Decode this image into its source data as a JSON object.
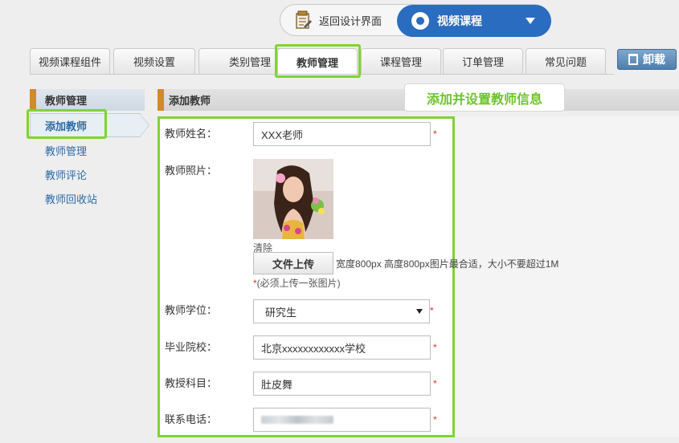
{
  "top": {
    "back_label": "返回设计界面",
    "course_label": "视频课程"
  },
  "tabs": [
    {
      "label": "视频课程组件"
    },
    {
      "label": "视频设置"
    },
    {
      "label": "类别管理"
    },
    {
      "label": "教师管理",
      "active": true
    },
    {
      "label": "课程管理"
    },
    {
      "label": "订单管理"
    },
    {
      "label": "常见问题"
    }
  ],
  "uninstall_label": "卸载",
  "sidebar": {
    "header": "教师管理",
    "items": [
      {
        "label": "添加教师",
        "active": true
      },
      {
        "label": "教师管理"
      },
      {
        "label": "教师评论"
      },
      {
        "label": "教师回收站"
      }
    ]
  },
  "section": {
    "title": "添加教师",
    "callout": "添加并设置教师信息"
  },
  "form": {
    "name_label": "教师姓名：",
    "name_value": "XXX老师",
    "photo_label": "教师照片：",
    "clear_label": "清除",
    "upload_label": "文件上传",
    "upload_hint": "宽度800px 高度800px图片最合适，大小不要超过1M",
    "upload_note_star": "*",
    "upload_note": "(必须上传一张图片)",
    "degree_label": "教师学位：",
    "degree_value": "研究生",
    "school_label": "毕业院校：",
    "school_value": "北京xxxxxxxxxxxx学校",
    "subject_label": "教授科目：",
    "subject_value": "肚皮舞",
    "phone_label": "联系电话：",
    "required_mark": "*"
  },
  "colors": {
    "highlight": "#7fd432",
    "accent_blue": "#2a6cbf",
    "link": "#2b6aa6",
    "bar_accent": "#d08a2c"
  }
}
